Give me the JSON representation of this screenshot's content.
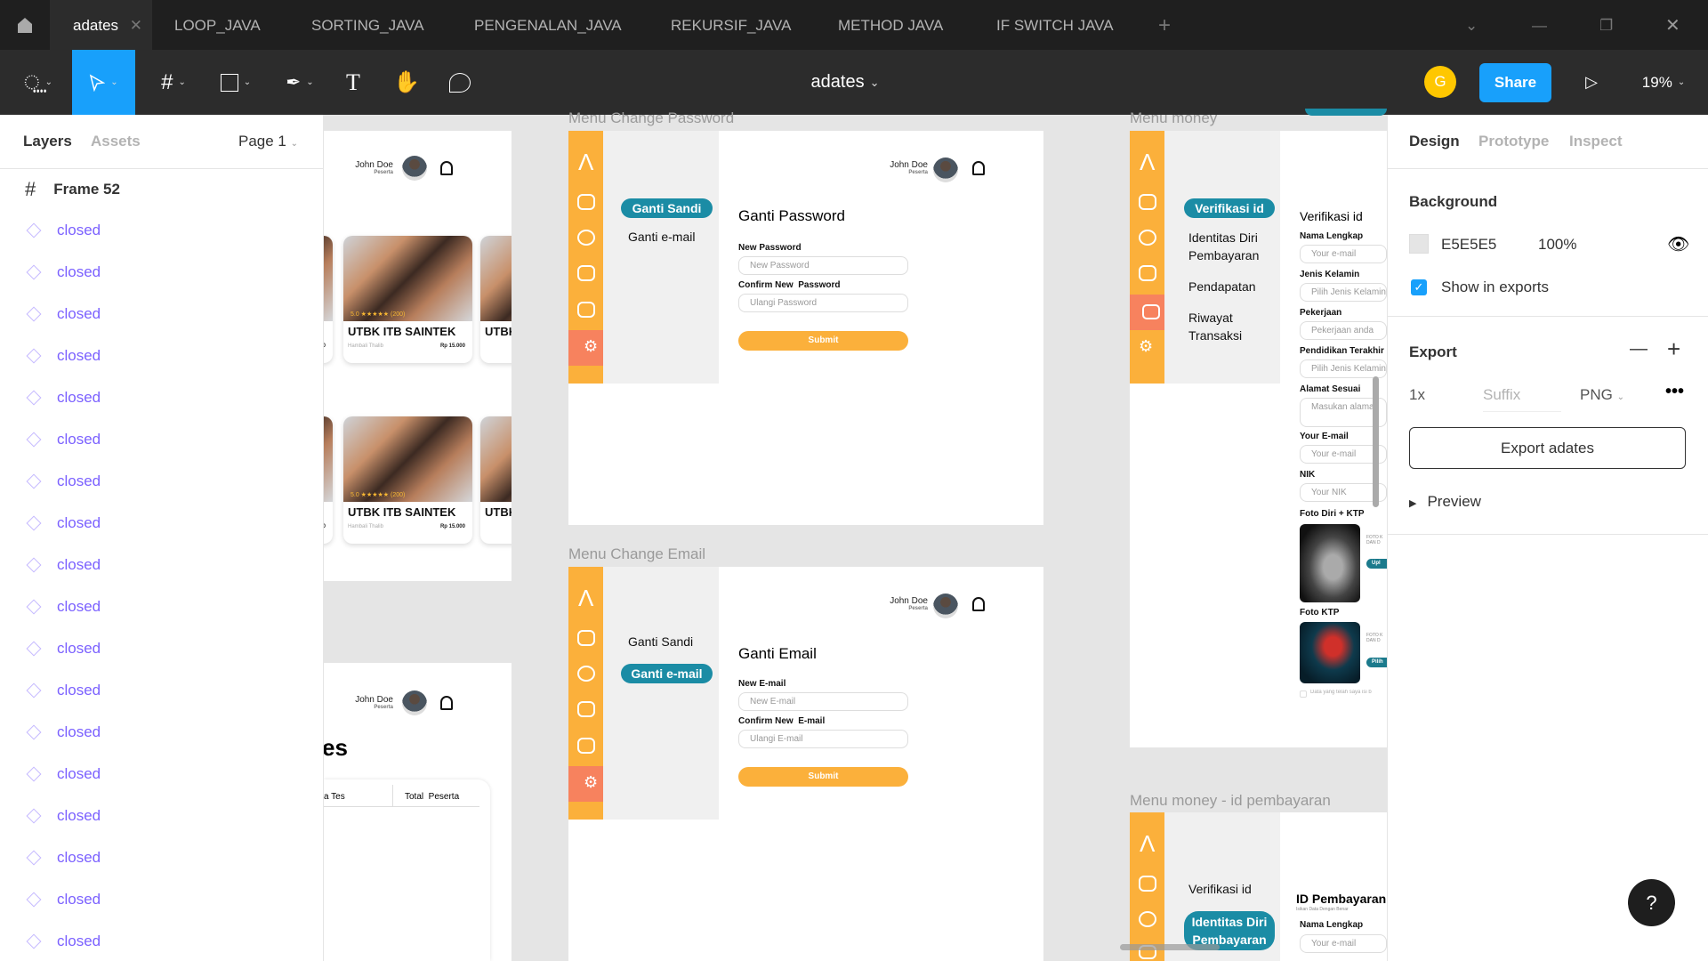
{
  "tabs": {
    "active": "adates",
    "others": [
      "LOOP_JAVA",
      "SORTING_JAVA",
      "PENGENALAN_JAVA",
      "REKURSIF_JAVA",
      "METHOD JAVA",
      "IF SWITCH JAVA"
    ],
    "add": "+"
  },
  "toolbar": {
    "file_title": "adates",
    "avatar_initial": "G",
    "share": "Share",
    "zoom": "19%"
  },
  "layers_panel": {
    "tab_layers": "Layers",
    "tab_assets": "Assets",
    "page": "Page 1",
    "frame": "Frame 52",
    "items": [
      "closed",
      "closed",
      "closed",
      "closed",
      "closed",
      "closed",
      "closed",
      "closed",
      "closed",
      "closed",
      "closed",
      "closed",
      "closed",
      "closed",
      "closed",
      "closed",
      "closed",
      "closed"
    ]
  },
  "design_panel": {
    "tabs": [
      "Design",
      "Prototype",
      "Inspect"
    ],
    "background_title": "Background",
    "bg_hex": "E5E5E5",
    "bg_opacity": "100%",
    "show_in_exports": "Show in exports",
    "export_title": "Export",
    "scale": "1x",
    "suffix_placeholder": "Suffix",
    "format": "PNG",
    "export_button": "Export adates",
    "preview": "Preview",
    "help": "?"
  },
  "canvas": {
    "user": {
      "name": "John Doe",
      "role": "Peserta"
    },
    "course_card": {
      "rating": "5.0 ★★★★★ (200)",
      "title": "UTBK ITB SAINTEK",
      "author": "Hambali Thalib",
      "price": "Rp 15.000",
      "partial_title": "UTBK",
      "partial_price": "0"
    },
    "table_frame": {
      "heading_fragment": "es",
      "col1": "a Tes",
      "col2": "Total  Peserta"
    },
    "change_password": {
      "label": "Menu Change Password",
      "nav": [
        "Ganti Sandi",
        "Ganti e-mail"
      ],
      "title": "Ganti Password",
      "field1_label": "New Password",
      "field1_placeholder": "New Password",
      "field2_label": "Confirm New  Password",
      "field2_placeholder": "Ulangi Password",
      "submit": "Submit"
    },
    "change_email": {
      "label": "Menu Change Email",
      "nav": [
        "Ganti Sandi",
        "Ganti e-mail"
      ],
      "title": "Ganti Email",
      "field1_label": "New E-mail",
      "field1_placeholder": "New E-mail",
      "field2_label": "Confirm New  E-mail",
      "field2_placeholder": "Ulangi E-mail",
      "submit": "Submit"
    },
    "money": {
      "label": "Menu money",
      "nav": [
        "Verifikasi id",
        "Identitas Diri Pembayaran",
        "Pendapatan",
        "Riwayat Transaksi"
      ],
      "title": "Verifikasi id",
      "fields": [
        {
          "label": "Nama Lengkap",
          "placeholder": "Your e-mail"
        },
        {
          "label": "Jenis Kelamin",
          "placeholder": "Pilih Jenis Kelamin"
        },
        {
          "label": "Pekerjaan",
          "placeholder": "Pekerjaan anda"
        },
        {
          "label": "Pendidikan Terakhir",
          "placeholder": "Pilih Jenis Kelamin"
        },
        {
          "label": "Alamat Sesuai",
          "placeholder": "Masukan alamat"
        },
        {
          "label": "Your E-mail",
          "placeholder": "Your e-mail"
        },
        {
          "label": "NIK",
          "placeholder": "Your NIK"
        }
      ],
      "photo1": "Foto Diri + KTP",
      "photo2": "Foto KTP",
      "photo_note": "FOTO K DAN D",
      "upload": "Upl",
      "pick": "Pilih",
      "consent": "Data yang telah saya isi b"
    },
    "money_id": {
      "label": "Menu money - id pembayaran",
      "nav": [
        "Verifikasi id",
        "Identitas Diri Pembayaran"
      ],
      "title": "ID Pembayaran",
      "subtitle": "Isikan Data Dengan Benar",
      "field_label": "Nama Lengkap",
      "field_placeholder": "Your e-mail"
    }
  }
}
